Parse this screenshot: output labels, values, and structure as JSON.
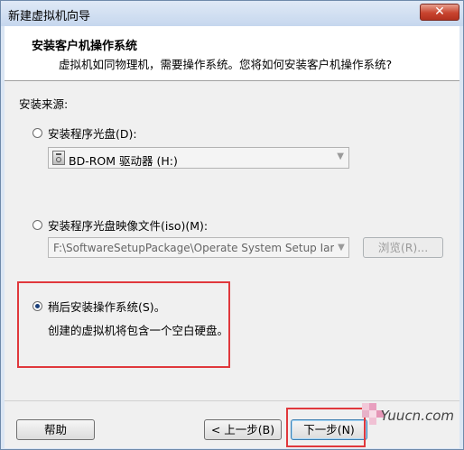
{
  "window": {
    "title": "新建虚拟机向导",
    "close_glyph": "✕"
  },
  "header": {
    "title": "安装客户机操作系统",
    "description": "虚拟机如同物理机，需要操作系统。您将如何安装客户机操作系统?"
  },
  "install_source": {
    "label": "安装来源:",
    "disc": {
      "label": "安装程序光盘(D):",
      "selected_drive": "BD-ROM 驱动器 (H:)",
      "checked": false
    },
    "iso": {
      "label": "安装程序光盘映像文件(iso)(M):",
      "path": "F:\\SoftwareSetupPackage\\Operate System Setup Iamag",
      "browse_label": "浏览(R)...",
      "checked": false
    },
    "later": {
      "label": "稍后安装操作系统(S)。",
      "description": "创建的虚拟机将包含一个空白硬盘。",
      "checked": true
    }
  },
  "footer": {
    "help_label": "帮助",
    "back_label": "< 上一步(B)",
    "next_label": "下一步(N)"
  },
  "watermark": {
    "text": "Yuucn.com"
  },
  "colors": {
    "highlight": "#e0383c",
    "close_button": "#c8442f"
  }
}
